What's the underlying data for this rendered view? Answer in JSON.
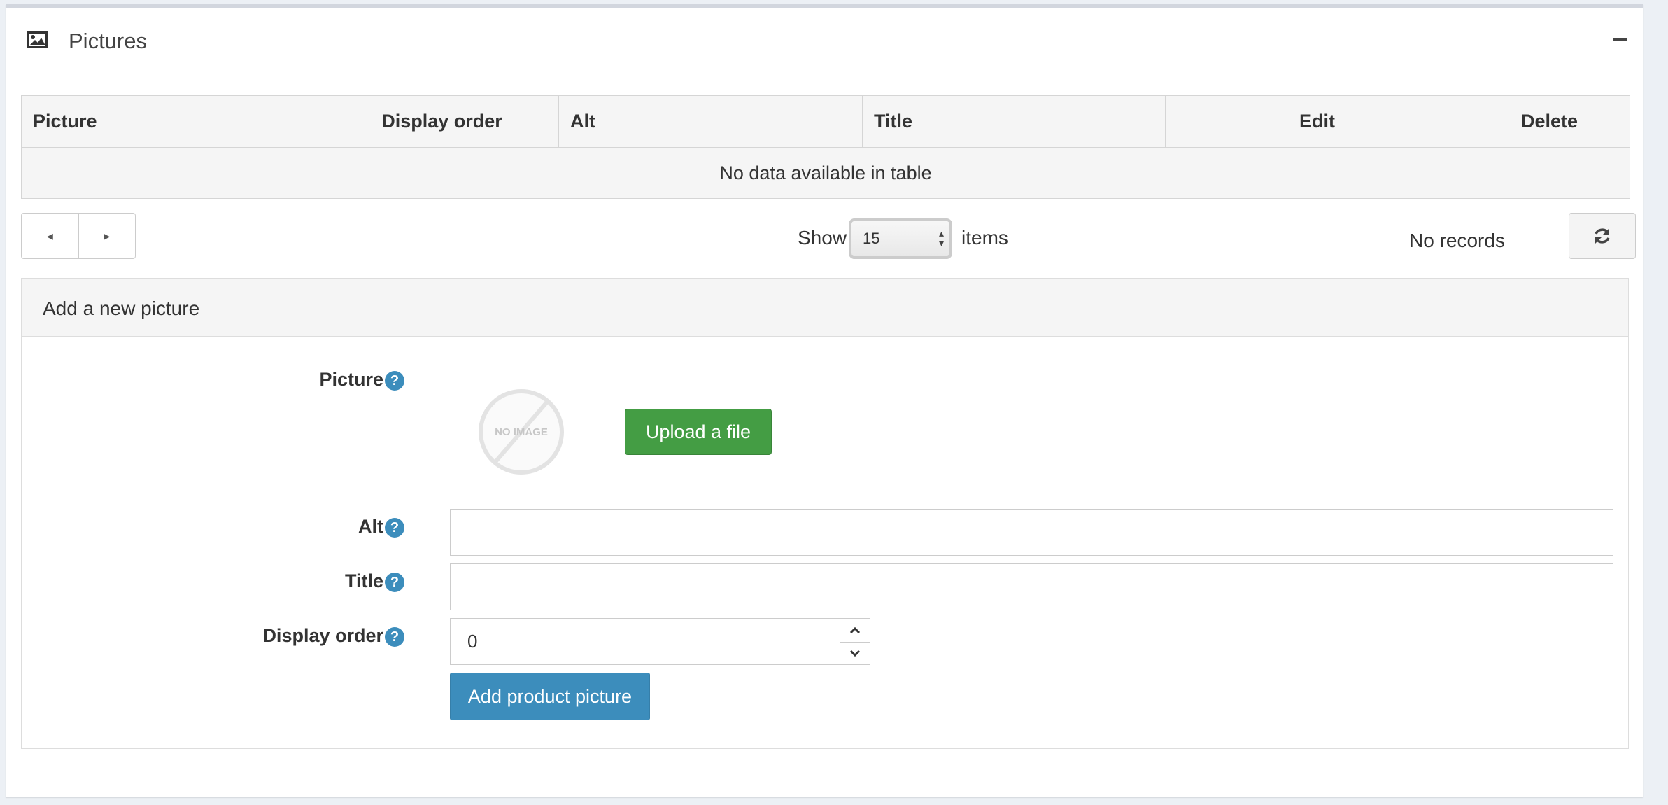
{
  "box": {
    "title": "Pictures",
    "icon": "picture-icon"
  },
  "grid": {
    "columns": [
      "Picture",
      "Display order",
      "Alt",
      "Title",
      "Edit",
      "Delete"
    ],
    "empty_message": "No data available in table"
  },
  "pager": {
    "prev_icon": "◂",
    "next_icon": "▸",
    "show_label": "Show",
    "page_size": "15",
    "items_label": "items",
    "records_text": "No records"
  },
  "add_panel": {
    "heading": "Add a new picture",
    "picture_label": "Picture",
    "no_image_text": "NO IMAGE",
    "upload_label": "Upload a file",
    "alt_label": "Alt",
    "title_label": "Title",
    "display_order_label": "Display order",
    "display_order_value": "0",
    "alt_value": "",
    "title_value": "",
    "submit_label": "Add product picture",
    "help_glyph": "?"
  },
  "colors": {
    "primary": "#3c8dbc",
    "success": "#449d44",
    "header_bg": "#f5f5f5"
  }
}
